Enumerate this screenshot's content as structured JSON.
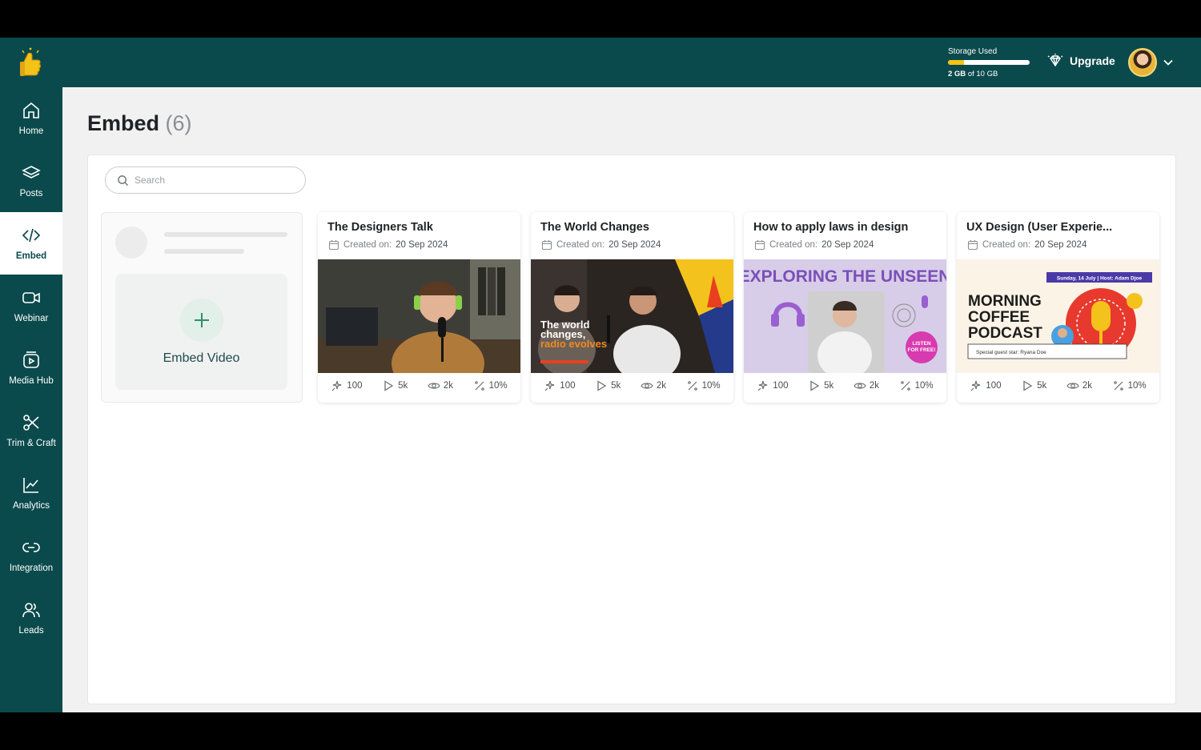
{
  "storage": {
    "label": "Storage Used",
    "used_value": "2 GB",
    "of_text": "of 10 GB",
    "fraction": 0.2
  },
  "header": {
    "upgrade_label": "Upgrade"
  },
  "sidebar": {
    "items": [
      {
        "label": "Home",
        "icon": "home-icon"
      },
      {
        "label": "Posts",
        "icon": "layers-icon"
      },
      {
        "label": "Embed",
        "icon": "code-icon",
        "active": true
      },
      {
        "label": "Webinar",
        "icon": "video-camera-icon"
      },
      {
        "label": "Media Hub",
        "icon": "media-play-icon"
      },
      {
        "label": "Trim & Craft",
        "icon": "scissors-icon"
      },
      {
        "label": "Analytics",
        "icon": "trend-chart-icon"
      },
      {
        "label": "Integration",
        "icon": "link-icon"
      },
      {
        "label": "Leads",
        "icon": "users-icon"
      }
    ]
  },
  "page": {
    "title": "Embed",
    "count": "(6)"
  },
  "search": {
    "placeholder": "Search"
  },
  "embed_card": {
    "label": "Embed Video"
  },
  "videos": [
    {
      "title": "The Designers Talk",
      "created_prefix": "Created on:",
      "created_date": "20 Sep 2024",
      "stats": {
        "clicks": "100",
        "plays": "5k",
        "views": "2k",
        "rate": "10%"
      }
    },
    {
      "title": "The World Changes",
      "created_prefix": "Created on:",
      "created_date": "20 Sep 2024",
      "stats": {
        "clicks": "100",
        "plays": "5k",
        "views": "2k",
        "rate": "10%"
      },
      "thumb_text": "The world changes, radio evolves"
    },
    {
      "title": "How to apply laws in design",
      "created_prefix": "Created on:",
      "created_date": "20 Sep 2024",
      "stats": {
        "clicks": "100",
        "plays": "5k",
        "views": "2k",
        "rate": "10%"
      },
      "thumb_text": "EXPLORING THE UNSEEN",
      "thumb_badge": "LISTEN FOR FREE!"
    },
    {
      "title": "UX Design (User Experie...",
      "created_prefix": "Created on:",
      "created_date": "20 Sep 2024",
      "stats": {
        "clicks": "100",
        "plays": "5k",
        "views": "2k",
        "rate": "10%"
      },
      "thumb_text": "MORNING COFFEE PODCAST",
      "thumb_banner": "Sunday, 14 July | Host: Adam Djoe",
      "thumb_guest": "Special guest star: Ryana Doe"
    }
  ],
  "colors": {
    "brand": "#0b4a4c",
    "accent": "#f3c318",
    "plus": "#2f8f6a"
  }
}
